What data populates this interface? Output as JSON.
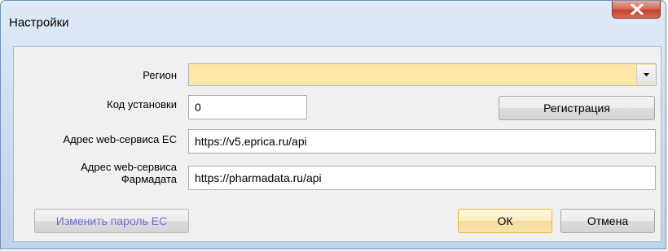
{
  "window": {
    "title": "Настройки"
  },
  "form": {
    "region": {
      "label": "Регион",
      "value": ""
    },
    "install_code": {
      "label": "Код установки",
      "value": "0"
    },
    "register_button": "Регистрация",
    "ec_service": {
      "label": "Адрес web-сервиса ЕС",
      "value": "https://v5.eprica.ru/api"
    },
    "pharmadata_service": {
      "label_line1": "Адрес web-сервиса",
      "label_line2": "Фармадата",
      "value": "https://pharmadata.ru/api"
    }
  },
  "buttons": {
    "change_password": "Изменить пароль ЕС",
    "ok": "ОК",
    "cancel": "Отмена"
  },
  "colors": {
    "region_highlight": "#fde8a7",
    "close_button": "#c6412c"
  }
}
